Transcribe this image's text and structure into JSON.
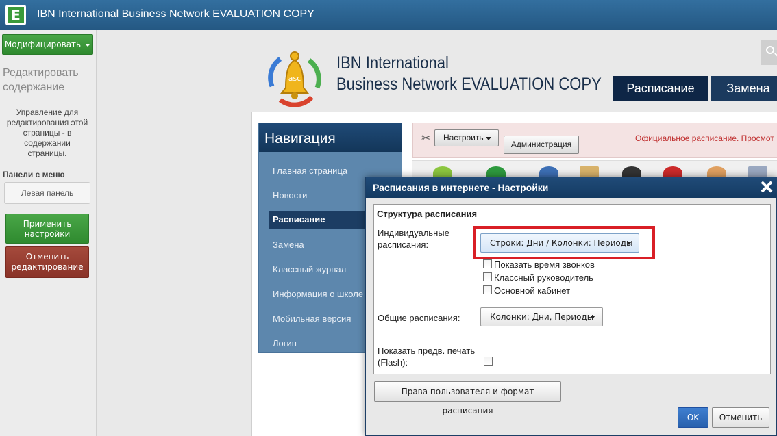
{
  "app": {
    "title": "IBN International Business Network EVALUATION COPY",
    "logo_letter": "E"
  },
  "left_panel": {
    "modify_label": "Модифицировать",
    "edit_title_line1": "Редактировать",
    "edit_title_line2": "содержание",
    "description_lines": [
      "Управление для",
      "редактирования этой",
      "страницы - в",
      "содержании",
      "страницы."
    ],
    "panels_label": "Панели с меню",
    "left_panel_button": "Левая панель",
    "apply_line1": "Применить",
    "apply_line2": "настройки",
    "cancel_line1": "Отменить",
    "cancel_line2": "редактирование"
  },
  "header": {
    "site_title_line1": "IBN International",
    "site_title_line2": "Business Network EVALUATION COPY",
    "logo_text": "asc",
    "tabs": [
      "Расписание",
      "Замена"
    ]
  },
  "navigation": {
    "title": "Навигация",
    "items": [
      "Главная страница",
      "Новости",
      "Расписание",
      "Замена",
      "Классный журнал",
      "Информация о школе",
      "Мобильная версия",
      "Логин"
    ],
    "active_index": 2
  },
  "toolbar": {
    "configure_label": "Настроить",
    "admin_label": "Администрация",
    "official_text": "Официальное расписание.  Просмот"
  },
  "dialog": {
    "title": "Расписания в интернете - Настройки",
    "group_title": "Структура расписания",
    "individual_label_line1": "Индивидуальные",
    "individual_label_line2": "расписания:",
    "individual_value": "Строки: Дни / Колонки: Периоды",
    "checkboxes": [
      {
        "label": "Показать время звонков",
        "checked": false
      },
      {
        "label": "Классный руководитель",
        "checked": false
      },
      {
        "label": "Основной кабинет",
        "checked": false
      }
    ],
    "general_label": "Общие расписания:",
    "general_value": "Колонки: Дни, Периоды",
    "preview_label_line1": "Показать предв. печать",
    "preview_label_line2": "(Flash):",
    "preview_checked": false,
    "rights_button": "Права пользователя и формат расписания",
    "ok_button": "OK",
    "cancel_button": "Отменить"
  },
  "colors": {
    "topbar": "#245883",
    "nav_bg": "#5d87ad",
    "dialog_header": "#143a62",
    "highlight": "#d91f26",
    "ok_button": "#2860ad"
  }
}
